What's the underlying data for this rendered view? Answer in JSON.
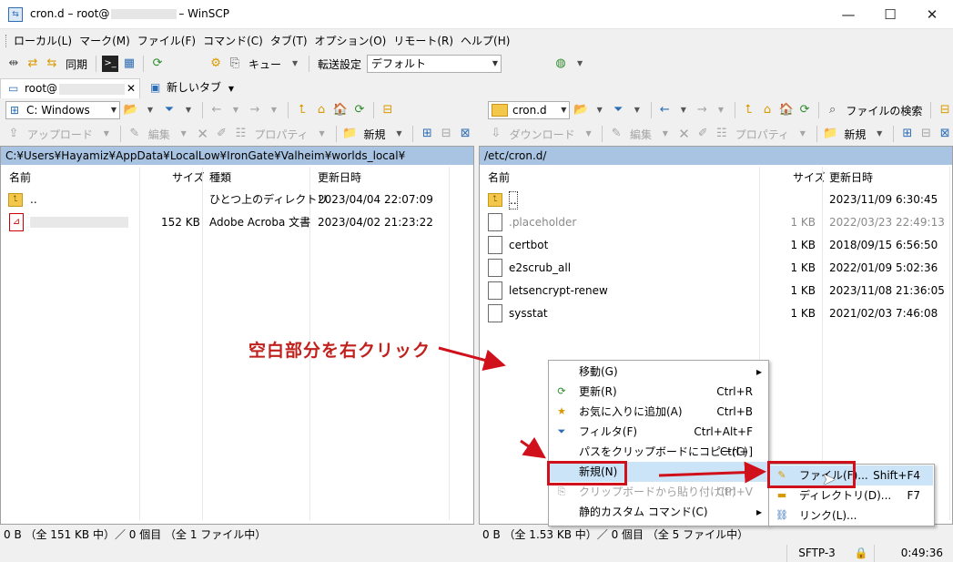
{
  "window": {
    "title_prefix": "cron.d – root@",
    "title_suffix": "– WinSCP",
    "minimize": "—",
    "maximize": "☐",
    "close": "✕"
  },
  "menu": [
    "ローカル(L)",
    "マーク(M)",
    "ファイル(F)",
    "コマンド(C)",
    "タブ(T)",
    "オプション(O)",
    "リモート(R)",
    "ヘルプ(H)"
  ],
  "toolbar1": {
    "sync": "同期",
    "queue": "キュー",
    "transfer_settings": "転送設定",
    "transfer_preset": "デフォルト"
  },
  "tabs": {
    "session": "root@",
    "new_tab": "新しいタブ"
  },
  "local_nav": {
    "drive": "C: Windows"
  },
  "remote_nav": {
    "dir": "cron.d",
    "find": "ファイルの検索"
  },
  "local_actions": {
    "upload": "アップロード",
    "edit": "編集",
    "properties": "プロパティ",
    "new": "新規"
  },
  "remote_actions": {
    "download": "ダウンロード",
    "edit": "編集",
    "properties": "プロパティ",
    "new": "新規"
  },
  "local": {
    "path": "C:¥Users¥Hayamiz¥AppData¥LocalLow¥IronGate¥Valheim¥worlds_local¥",
    "headers": {
      "name": "名前",
      "size": "サイズ",
      "type": "種類",
      "modified": "更新日時"
    },
    "rows": [
      {
        "name": "..",
        "size": "",
        "type": "ひとつ上のディレクトリ",
        "modified": "2023/04/04 22:07:09"
      },
      {
        "name": "",
        "size": "152 KB",
        "type": "Adobe Acroba 文書",
        "modified": "2023/04/02 21:23:22"
      }
    ],
    "status": "0 B （全 151 KB 中）／ 0 個目 （全 1 ファイル中）"
  },
  "remote": {
    "path": "/etc/cron.d/",
    "headers": {
      "name": "名前",
      "size": "サイズ",
      "modified": "更新日時"
    },
    "rows": [
      {
        "name": "..",
        "size": "",
        "modified": "2023/11/09 6:30:45"
      },
      {
        "name": ".placeholder",
        "size": "1 KB",
        "modified": "2022/03/23 22:49:13"
      },
      {
        "name": "certbot",
        "size": "1 KB",
        "modified": "2018/09/15 6:56:50"
      },
      {
        "name": "e2scrub_all",
        "size": "1 KB",
        "modified": "2022/01/09 5:02:36"
      },
      {
        "name": "letsencrypt-renew",
        "size": "1 KB",
        "modified": "2023/11/08 21:36:05"
      },
      {
        "name": "sysstat",
        "size": "1 KB",
        "modified": "2021/02/03 7:46:08"
      }
    ],
    "status": "0 B （全 1.53 KB 中）／ 0 個目 （全 5 ファイル中）"
  },
  "context_menu": [
    {
      "label": "移動(G)",
      "shortcut": "",
      "submenu": true
    },
    {
      "label": "更新(R)",
      "shortcut": "Ctrl+R"
    },
    {
      "label": "お気に入りに追加(A)",
      "shortcut": "Ctrl+B"
    },
    {
      "label": "フィルタ(F)",
      "shortcut": "Ctrl+Alt+F"
    },
    {
      "label": "パスをクリップボードにコピー(C)",
      "shortcut": "Ctrl+]"
    },
    {
      "label": "新規(N)",
      "shortcut": "",
      "submenu": true
    },
    {
      "label": "クリップボードから貼り付け(P)",
      "shortcut": "Ctrl+V"
    },
    {
      "label": "静的カスタム コマンド(C)",
      "shortcut": "",
      "submenu": true
    }
  ],
  "submenu": [
    {
      "label": "ファイル(F)...",
      "shortcut": "Shift+F4"
    },
    {
      "label": "ディレクトリ(D)...",
      "shortcut": "F7"
    },
    {
      "label": "リンク(L)...",
      "shortcut": ""
    }
  ],
  "annotation": {
    "callout": "空白部分を右クリック"
  },
  "bottom": {
    "protocol": "SFTP-3",
    "time": "0:49:36"
  }
}
